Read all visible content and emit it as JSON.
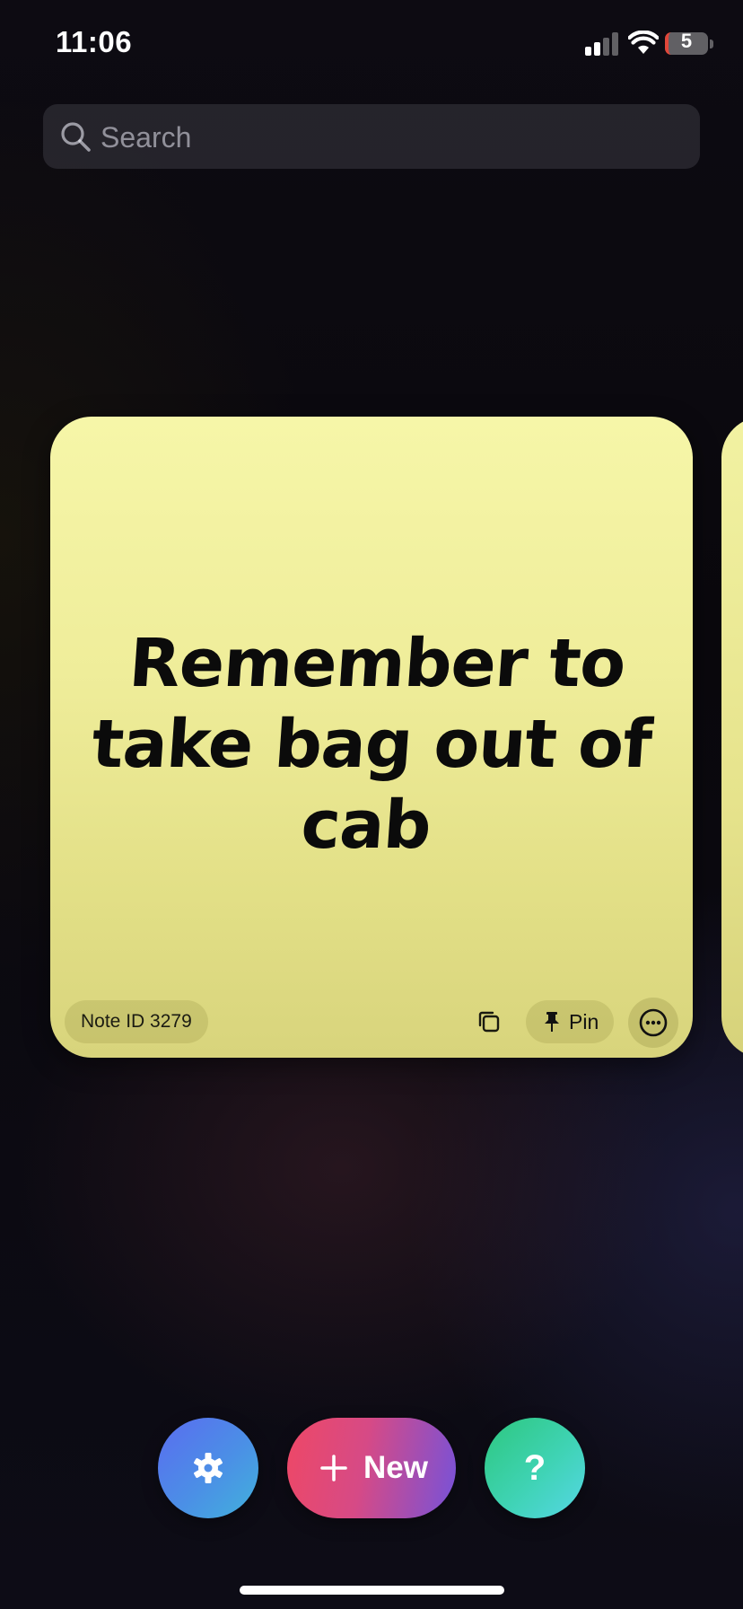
{
  "status_bar": {
    "time": "11:06",
    "battery_level": "5"
  },
  "search": {
    "placeholder": "Search",
    "value": ""
  },
  "note": {
    "text": "Remember to take bag out of cab",
    "id_label": "Note ID 3279",
    "pin_label": "Pin",
    "color": "#efed9a"
  },
  "actions": {
    "new_label": "New",
    "help_label": "?"
  },
  "icons": {
    "search": "search-icon",
    "copy": "copy-icon",
    "pin": "pin-icon",
    "more": "ellipsis-circle-icon",
    "settings": "gear-icon",
    "new": "plus-icon"
  }
}
